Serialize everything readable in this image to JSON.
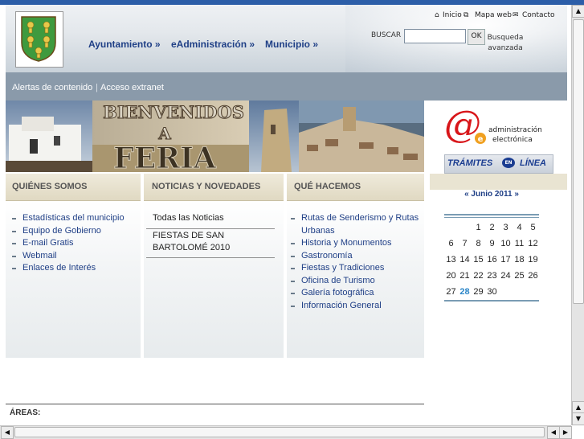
{
  "header": {
    "nav": [
      {
        "label": "Ayuntamiento »"
      },
      {
        "label": "eAdministración »"
      },
      {
        "label": "Municipio »"
      }
    ],
    "toplinks": {
      "inicio": "Inicio",
      "mapa": "Mapa web",
      "contacto": "Contacto"
    },
    "search": {
      "label": "BUSCAR",
      "value": "",
      "ok": "OK",
      "advanced": "Busqueda avanzada"
    }
  },
  "alertbar": {
    "alertas": "Alertas de contenido",
    "extranet": "Acceso extranet",
    "separator": "|"
  },
  "banner": {
    "line1": "BIENVENIDOS",
    "line2": "A",
    "line3": "FERIA"
  },
  "sidebar": {
    "admin": {
      "at": "@",
      "sub": "e",
      "line1": "administración",
      "line2": "electrónica"
    },
    "tramites": {
      "part1": "TRÁMITES",
      "en": "EN",
      "part2": "LÍNEA"
    },
    "calendar": {
      "month": "« Junio 2011 »",
      "today": "28",
      "weeks": [
        [
          "",
          "",
          "1",
          "2",
          "3",
          "4",
          "5"
        ],
        [
          "6",
          "7",
          "8",
          "9",
          "10",
          "11",
          "12"
        ],
        [
          "13",
          "14",
          "15",
          "16",
          "17",
          "18",
          "19"
        ],
        [
          "20",
          "21",
          "22",
          "23",
          "24",
          "25",
          "26"
        ],
        [
          "27",
          "28",
          "29",
          "30",
          "",
          "",
          ""
        ]
      ]
    }
  },
  "columns": {
    "quienes": {
      "title": "QUIÉNES SOMOS",
      "items": [
        "Estadísticas del municipio",
        "Equipo de Gobierno",
        "E-mail Gratis",
        "Webmail",
        "Enlaces de Interés"
      ]
    },
    "noticias": {
      "title": "NOTICIAS Y NOVEDADES",
      "all": "Todas las Noticias",
      "item1_line1": "FIESTAS DE SAN",
      "item1_line2": "BARTOLOMÉ 2010"
    },
    "hacemos": {
      "title": "QUÉ HACEMOS",
      "items": [
        "Rutas de Senderismo y Rutas",
        "Urbanas",
        "Historia y Monumentos",
        "Gastronomía",
        "Fiestas y Tradiciones",
        "Oficina de Turismo",
        "Galería fotográfica",
        "Información General"
      ]
    }
  },
  "footer": {
    "areas": "ÁREAS:"
  },
  "colors": {
    "accent": "#1f3f86",
    "alertbar": "#8a9aaa",
    "column_header": "#e9e4d2",
    "today": "#2c86c8"
  }
}
